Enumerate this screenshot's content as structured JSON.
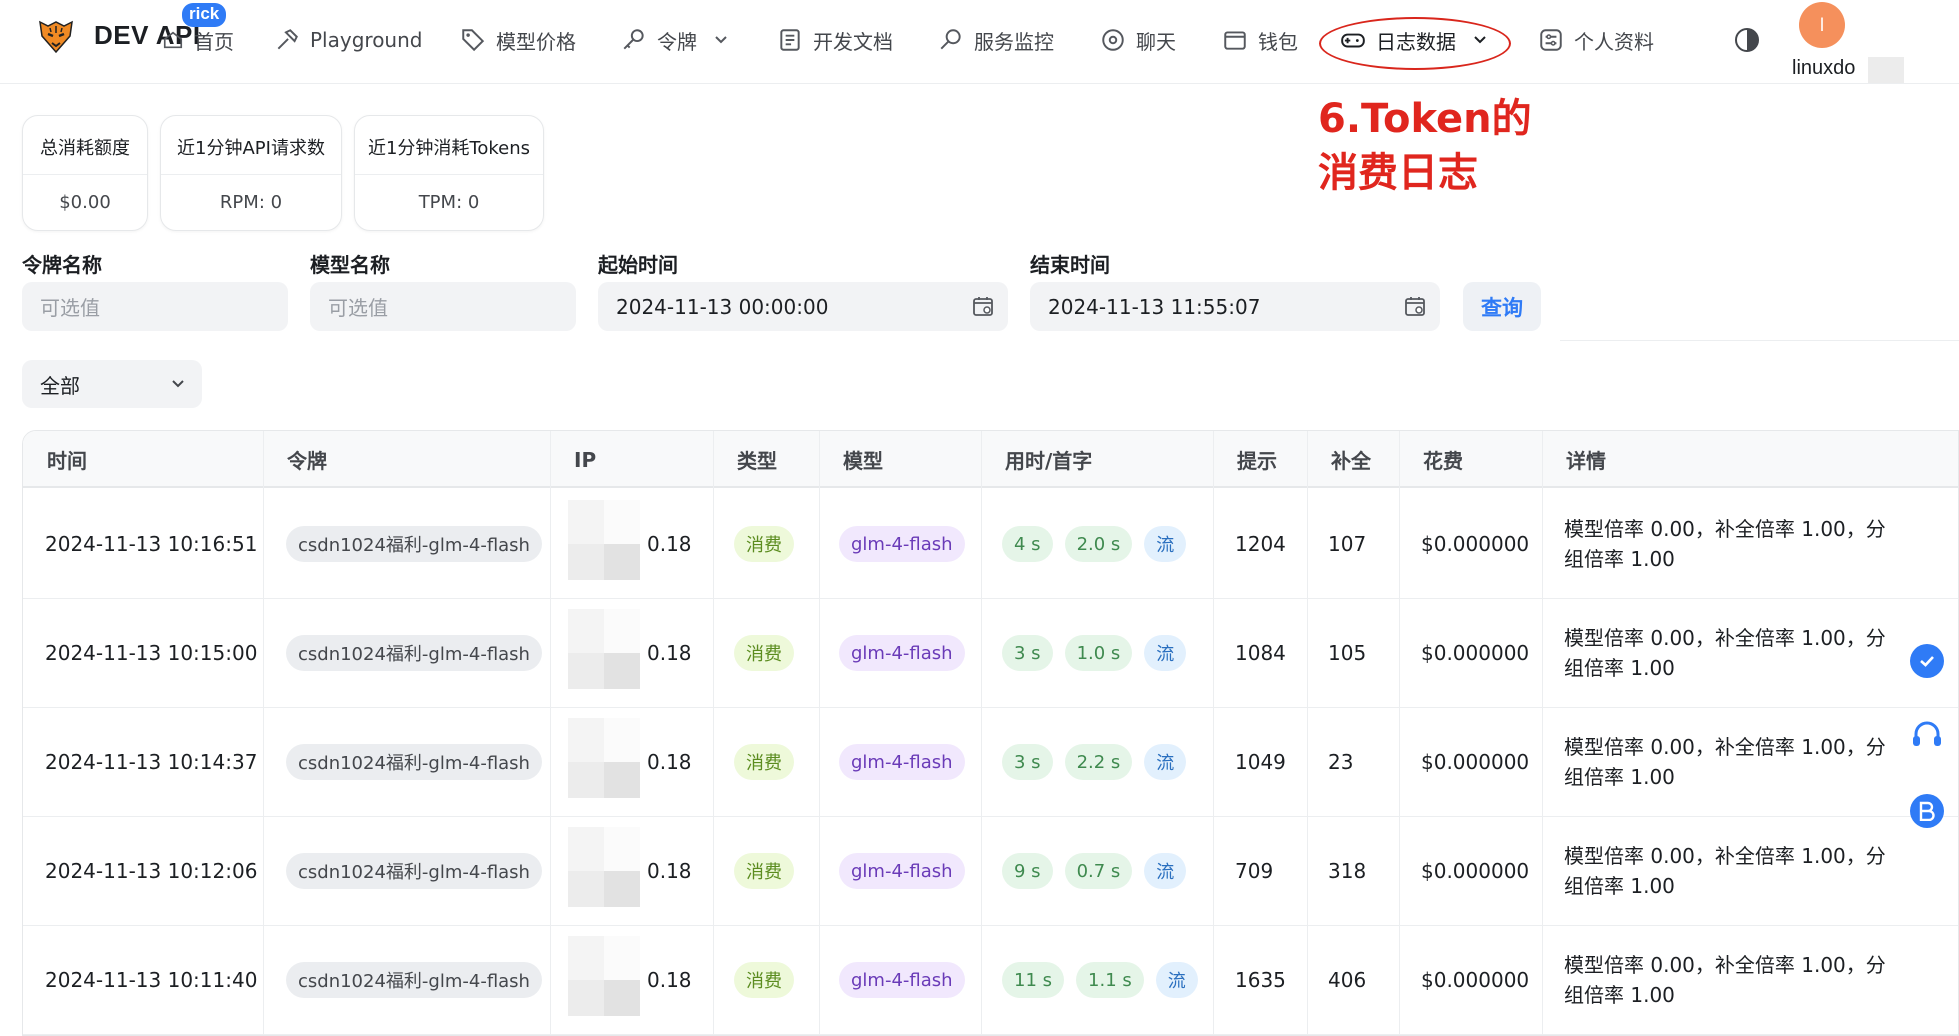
{
  "header": {
    "brand": "DEV API",
    "badge": "rick",
    "nav": [
      {
        "label": "首页"
      },
      {
        "label": "Playground"
      },
      {
        "label": "模型价格"
      },
      {
        "label": "令牌"
      },
      {
        "label": "开发文档"
      },
      {
        "label": "服务监控"
      },
      {
        "label": "聊天"
      },
      {
        "label": "钱包"
      },
      {
        "label": "日志数据"
      },
      {
        "label": "个人资料"
      }
    ],
    "avatar_initial": "l",
    "username": "linuxdo",
    "accent_color": "#2f7bf6",
    "highlight_color": "#d9261c"
  },
  "annotation": {
    "line1": "6.Token的",
    "line2": "消费日志",
    "color": "#e0261e"
  },
  "stats": [
    {
      "title": "总消耗额度",
      "value": "$0.00"
    },
    {
      "title": "近1分钟API请求数",
      "value": "RPM: 0"
    },
    {
      "title": "近1分钟消耗Tokens",
      "value": "TPM: 0"
    }
  ],
  "filters": {
    "token_name": {
      "label": "令牌名称",
      "placeholder": "可选值"
    },
    "model_name": {
      "label": "模型名称",
      "placeholder": "可选值"
    },
    "start_time": {
      "label": "起始时间",
      "value": "2024-11-13 00:00:00"
    },
    "end_time": {
      "label": "结束时间",
      "value": "2024-11-13 11:55:07"
    },
    "query_label": "查询",
    "type_select": "全部"
  },
  "table": {
    "columns": [
      "时间",
      "令牌",
      "IP",
      "类型",
      "模型",
      "用时/首字",
      "提示",
      "补全",
      "花费",
      "详情"
    ],
    "rows": [
      {
        "time": "2024-11-13 10:16:51",
        "token": "csdn1024福利-glm-4-flash",
        "ip": "0.18",
        "type": "消费",
        "model": "glm-4-flash",
        "duration": "4 s",
        "first": "2.0 s",
        "stream": "流",
        "prompt": "1204",
        "completion": "107",
        "cost": "$0.000000",
        "detail": "模型倍率 0.00，补全倍率 1.00，分组倍率 1.00"
      },
      {
        "time": "2024-11-13 10:15:00",
        "token": "csdn1024福利-glm-4-flash",
        "ip": "0.18",
        "type": "消费",
        "model": "glm-4-flash",
        "duration": "3 s",
        "first": "1.0 s",
        "stream": "流",
        "prompt": "1084",
        "completion": "105",
        "cost": "$0.000000",
        "detail": "模型倍率 0.00，补全倍率 1.00，分组倍率 1.00"
      },
      {
        "time": "2024-11-13 10:14:37",
        "token": "csdn1024福利-glm-4-flash",
        "ip": "0.18",
        "type": "消费",
        "model": "glm-4-flash",
        "duration": "3 s",
        "first": "2.2 s",
        "stream": "流",
        "prompt": "1049",
        "completion": "23",
        "cost": "$0.000000",
        "detail": "模型倍率 0.00，补全倍率 1.00，分组倍率 1.00"
      },
      {
        "time": "2024-11-13 10:12:06",
        "token": "csdn1024福利-glm-4-flash",
        "ip": "0.18",
        "type": "消费",
        "model": "glm-4-flash",
        "duration": "9 s",
        "first": "0.7 s",
        "stream": "流",
        "prompt": "709",
        "completion": "318",
        "cost": "$0.000000",
        "detail": "模型倍率 0.00，补全倍率 1.00，分组倍率 1.00"
      },
      {
        "time": "2024-11-13 10:11:40",
        "token": "csdn1024福利-glm-4-flash",
        "ip": "0.18",
        "type": "消费",
        "model": "glm-4-flash",
        "duration": "11 s",
        "first": "1.1 s",
        "stream": "流",
        "prompt": "1635",
        "completion": "406",
        "cost": "$0.000000",
        "detail": "模型倍率 0.00，补全倍率 1.00，分组倍率 1.00"
      }
    ]
  },
  "side_icons": [
    "check-icon",
    "headset-icon",
    "bing-icon"
  ]
}
